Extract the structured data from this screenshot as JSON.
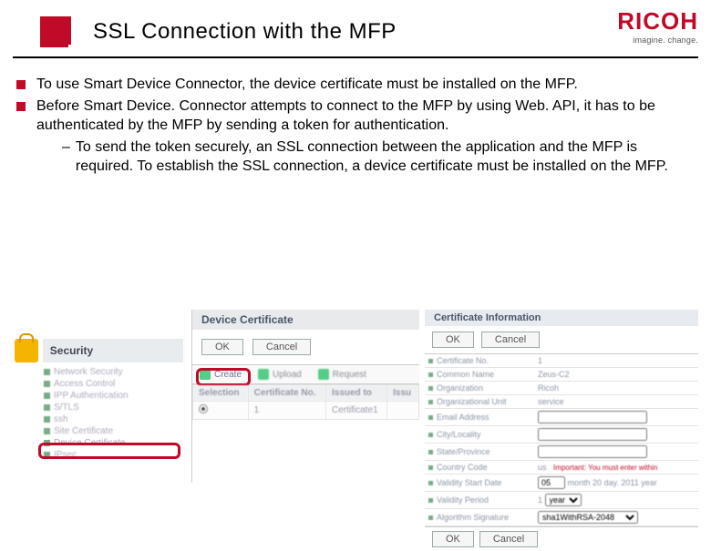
{
  "header": {
    "title": "SSL Connection with the MFP",
    "brand": "RICOH",
    "tagline": "imagine. change."
  },
  "bullets": {
    "b1": "To use Smart Device Connector, the device certificate must be installed on the MFP.",
    "b2": "Before Smart Device. Connector attempts to connect to the MFP by using Web. API, it has to be authenticated by the MFP by sending a token for authentication.",
    "sub1": "To send the token securely, an SSL connection between the application and the MFP is required. To establish the SSL connection, a device certificate must be installed on the MFP."
  },
  "shot1": {
    "title": "Security",
    "items": [
      "Network Security",
      "Access Control",
      "IPP Authentication",
      "S/TLS",
      "ssh",
      "Site Certificate",
      "Device Certificate",
      "IPsec"
    ]
  },
  "shot2": {
    "title": "Device Certificate",
    "ok": "OK",
    "cancel": "Cancel",
    "create": "Create",
    "upload": "Upload",
    "request": "Request",
    "th1": "Selection",
    "th2": "Certificate No.",
    "th3": "Issued to",
    "th4": "Issu",
    "cell_no": "1",
    "cell_cert": "Certificate1"
  },
  "shot3": {
    "title": "Certificate Information",
    "ok": "OK",
    "cancel": "Cancel",
    "rows": {
      "r1l": "Certificate No.",
      "r1v": "1",
      "r2l": "Common Name",
      "r2v": "Zeus-C2",
      "r3l": "Organization",
      "r3v": "Ricoh",
      "r4l": "Organizational Unit",
      "r4v": "service",
      "r5l": "Email Address",
      "r5v": "",
      "r6l": "City/Locality",
      "r6v": "",
      "r7l": "State/Province",
      "r7v": "",
      "r8l": "Country Code",
      "r8v": "us",
      "r8imp": "Important: You must enter within",
      "r9l": "Validity Start Date",
      "r10l": "Validity Period",
      "r10v": "1",
      "r10u": "year",
      "r11l": "Algorithm Signature",
      "r11v": "sha1WithRSA-2048"
    },
    "dates": {
      "m": "05",
      "d": "month 20",
      "y": "day. 2011",
      "x": "year"
    }
  }
}
